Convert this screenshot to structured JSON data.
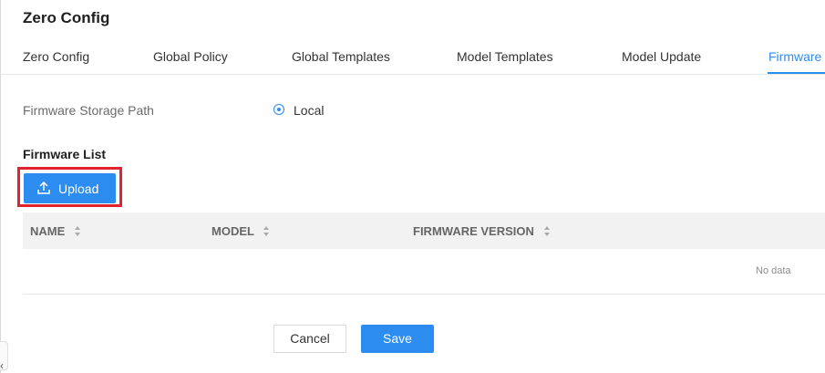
{
  "page": {
    "title": "Zero Config"
  },
  "tabs": [
    {
      "label": "Zero Config",
      "active": false
    },
    {
      "label": "Global Policy",
      "active": false
    },
    {
      "label": "Global Templates",
      "active": false
    },
    {
      "label": "Model Templates",
      "active": false
    },
    {
      "label": "Model Update",
      "active": false
    },
    {
      "label": "Firmware",
      "active": true
    }
  ],
  "storage": {
    "label": "Firmware Storage Path",
    "option": "Local",
    "selected": true
  },
  "firmware_list": {
    "title": "Firmware List",
    "upload_label": "Upload",
    "columns": [
      "NAME",
      "MODEL",
      "FIRMWARE VERSION"
    ],
    "rows": [],
    "empty_text": "No data"
  },
  "footer": {
    "cancel_label": "Cancel",
    "save_label": "Save"
  },
  "colors": {
    "accent": "#2d8cf0",
    "highlight": "#e0232f"
  }
}
